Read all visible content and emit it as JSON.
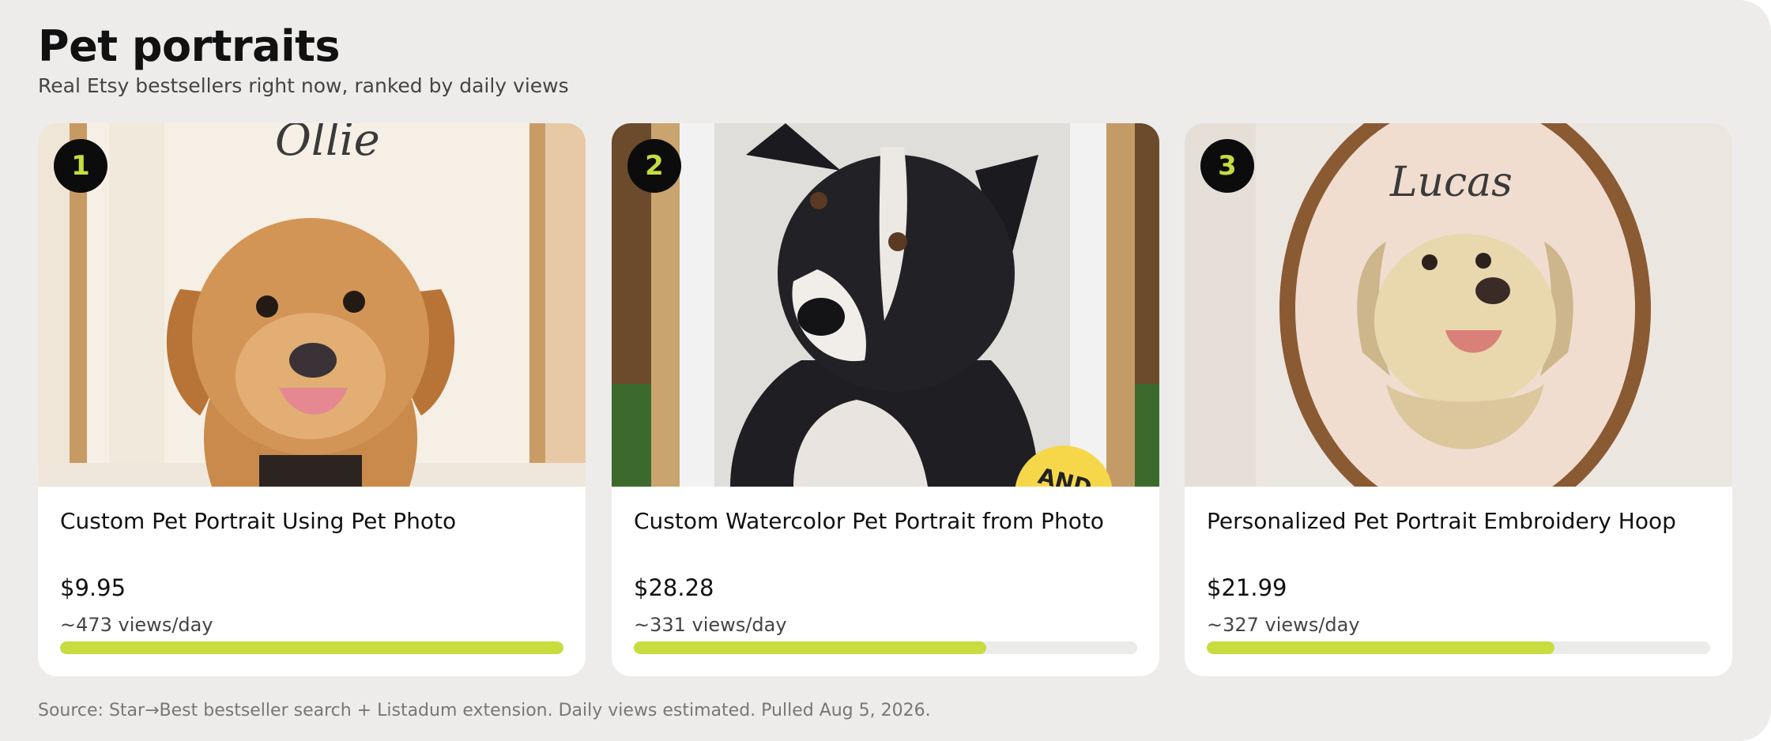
{
  "header": {
    "title": "Pet portraits",
    "subtitle": "Real Etsy bestsellers right now, ranked by daily views"
  },
  "products": [
    {
      "rank": "1",
      "title": "Custom Pet Portrait Using Pet Photo",
      "price": "$9.95",
      "views": "~473 views/day",
      "views_fraction": 1.0,
      "image": "dog-portrait-ollie",
      "image_script_text": "Ollie"
    },
    {
      "rank": "2",
      "title": "Custom Watercolor Pet Portrait from Photo",
      "price": "$28.28",
      "views": "~331 views/day",
      "views_fraction": 0.7,
      "image": "watercolor-border-collie",
      "image_badge_text": "AND"
    },
    {
      "rank": "3",
      "title": "Personalized Pet Portrait Embroidery Hoop",
      "price": "$21.99",
      "views": "~327 views/day",
      "views_fraction": 0.69,
      "image": "embroidery-hoop-golden-retriever",
      "image_script_text": "Lucas"
    }
  ],
  "footer": {
    "source": "Source: Star→Best bestseller search + Listadum extension. Daily views estimated. Pulled Aug 5, 2026."
  },
  "colors": {
    "accent": "#c8dc3f",
    "badge_bg": "#0c0c0c",
    "page_bg": "#edecea",
    "track_bg": "#ebebea"
  }
}
